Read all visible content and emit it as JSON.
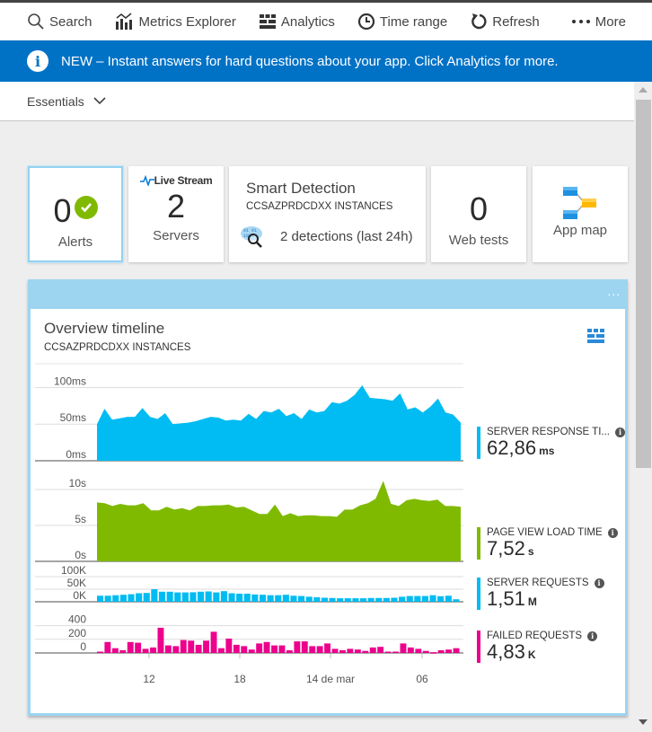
{
  "toolbar": {
    "items": [
      {
        "label": "Search",
        "icon": "search-icon"
      },
      {
        "label": "Metrics Explorer",
        "icon": "metrics-explorer-icon"
      },
      {
        "label": "Analytics",
        "icon": "analytics-icon"
      },
      {
        "label": "Time range",
        "icon": "clock-icon"
      },
      {
        "label": "Refresh",
        "icon": "refresh-icon"
      },
      {
        "label": "More",
        "icon": "more-dots-icon"
      }
    ]
  },
  "banner": {
    "icon": "info-icon",
    "text": "NEW – Instant answers for hard questions about your app. Click Analytics for more."
  },
  "essentials": {
    "label": "Essentials",
    "icon": "chevron-down-icon"
  },
  "tiles": {
    "alerts": {
      "value": "0",
      "label": "Alerts",
      "status_icon": "check-circle-icon",
      "status_color": "#7fba00"
    },
    "servers": {
      "badge": "Live Stream",
      "value": "2",
      "label": "Servers"
    },
    "smart_detection": {
      "title": "Smart Detection",
      "subtitle": "CCSAZPRDCDXX INSTANCES",
      "detections": "2 detections (last 24h)"
    },
    "web_tests": {
      "value": "0",
      "label": "Web tests"
    },
    "app_map": {
      "label": "App map"
    }
  },
  "overview": {
    "title": "Overview timeline",
    "subtitle": "CCSAZPRDCDXX INSTANCES",
    "more_label": "...",
    "metrics": [
      {
        "name": "SERVER RESPONSE TI...",
        "value": "62,86",
        "unit": "ms",
        "color": "#00bcf2"
      },
      {
        "name": "PAGE VIEW LOAD TIME",
        "value": "7,52",
        "unit": "s",
        "color": "#7fba00"
      },
      {
        "name": "SERVER REQUESTS",
        "value": "1,51",
        "unit": "M",
        "color": "#00bcf2"
      },
      {
        "name": "FAILED REQUESTS",
        "value": "4,83",
        "unit": "K",
        "color": "#ec008c"
      }
    ]
  },
  "chart_data": [
    {
      "type": "area",
      "title": "Server response time",
      "ylabel": "ms",
      "yticks": [
        "0ms",
        "50ms",
        "100ms"
      ],
      "ytick_values": [
        0,
        50,
        100
      ],
      "ylim": [
        0,
        130
      ],
      "color": "#00bcf2",
      "values": [
        50,
        71,
        56,
        58,
        60,
        60,
        72,
        60,
        57,
        65,
        50,
        51,
        52,
        54,
        57,
        60,
        59,
        55,
        56,
        55,
        64,
        57,
        68,
        66,
        71,
        61,
        65,
        57,
        70,
        66,
        68,
        80,
        78,
        82,
        90,
        103,
        86,
        85,
        84,
        82,
        92,
        70,
        73,
        66,
        74,
        85,
        66,
        63,
        52
      ]
    },
    {
      "type": "area",
      "title": "Page view load time",
      "ylabel": "s",
      "yticks": [
        "0s",
        "5s",
        "10s"
      ],
      "ytick_values": [
        0,
        5,
        10
      ],
      "ylim": [
        0,
        12
      ],
      "color": "#7fba00",
      "values": [
        8.2,
        8.1,
        7.7,
        8.0,
        7.8,
        7.8,
        8.1,
        7.1,
        7.1,
        7.6,
        7.2,
        7.4,
        7.1,
        7.7,
        7.7,
        7.8,
        7.8,
        7.9,
        7.5,
        7.6,
        7.1,
        6.6,
        6.6,
        7.9,
        6.3,
        6.7,
        6.3,
        6.4,
        6.4,
        6.3,
        6.3,
        6.2,
        7.2,
        7.2,
        7.8,
        8.1,
        8.7,
        11.2,
        8.0,
        7.7,
        8.5,
        8.7,
        8.5,
        8.4,
        8.6,
        7.7,
        7.7,
        7.6
      ]
    },
    {
      "type": "bar",
      "title": "Server requests",
      "yticks": [
        "0K",
        "50K",
        "100K"
      ],
      "ytick_values": [
        0,
        50,
        100
      ],
      "ylim": [
        0,
        125
      ],
      "color": "#00bcf2",
      "values": [
        24,
        24,
        26,
        28,
        30,
        34,
        35,
        50,
        40,
        40,
        37,
        37,
        38,
        40,
        41,
        37,
        42,
        34,
        32,
        32,
        29,
        28,
        26,
        26,
        28,
        24,
        23,
        20,
        18,
        16,
        15,
        14,
        14,
        14,
        14,
        15,
        15,
        15,
        16,
        20,
        23,
        23,
        23,
        26,
        22,
        24,
        10
      ]
    },
    {
      "type": "bar",
      "title": "Failed requests",
      "yticks": [
        "0",
        "200",
        "400"
      ],
      "ytick_values": [
        0,
        200,
        400
      ],
      "ylim": [
        0,
        500
      ],
      "color": "#ec008c",
      "values": [
        20,
        160,
        70,
        40,
        160,
        150,
        60,
        80,
        370,
        110,
        100,
        190,
        180,
        120,
        180,
        310,
        70,
        210,
        120,
        100,
        50,
        140,
        160,
        110,
        110,
        40,
        170,
        170,
        100,
        100,
        140,
        60,
        40,
        60,
        50,
        30,
        80,
        90,
        20,
        20,
        140,
        80,
        60,
        30,
        10,
        40,
        50,
        70
      ],
      "xticks": [
        "12",
        "18",
        "14 de mar",
        "06"
      ]
    }
  ]
}
